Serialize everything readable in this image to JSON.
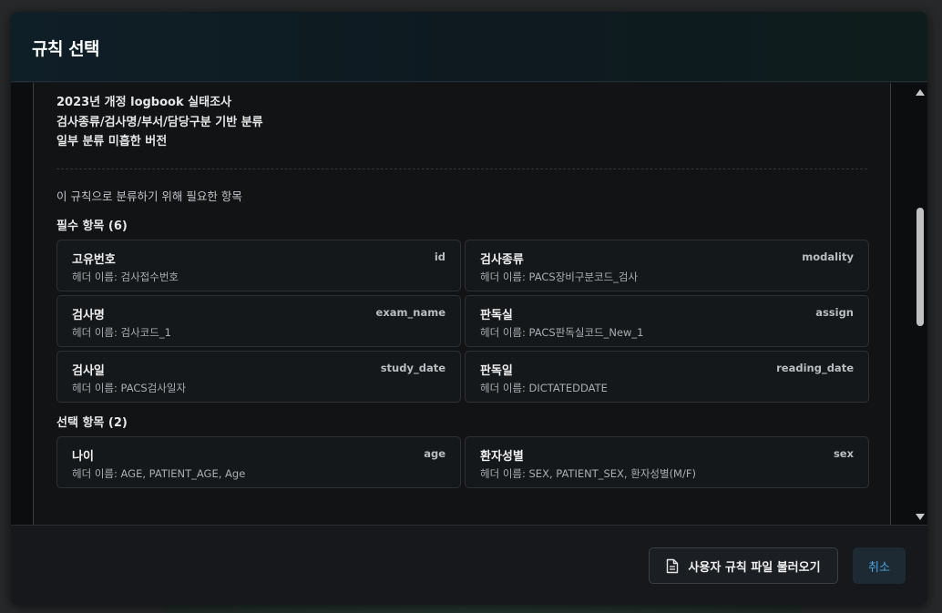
{
  "modal": {
    "title": "규칙 선택"
  },
  "rule": {
    "description_lines": [
      "2023년 개정 logbook 실태조사",
      "검사종류/검사명/부서/담당구분 기반 분류",
      "일부 분류 미흡한 버전"
    ],
    "required_fields_caption": "이 규칙으로 분류하기 위해 필요한 항목",
    "required_group_title": "필수 항목 (6)",
    "required_fields": [
      {
        "label": "고유번호",
        "key": "id",
        "header": "헤더 이름: 검사접수번호"
      },
      {
        "label": "검사종류",
        "key": "modality",
        "header": "헤더 이름: PACS장비구분코드_검사"
      },
      {
        "label": "검사명",
        "key": "exam_name",
        "header": "헤더 이름: 검사코드_1"
      },
      {
        "label": "판독실",
        "key": "assign",
        "header": "헤더 이름: PACS판독실코드_New_1"
      },
      {
        "label": "검사일",
        "key": "study_date",
        "header": "헤더 이름: PACS검사일자"
      },
      {
        "label": "판독일",
        "key": "reading_date",
        "header": "헤더 이름: DICTATEDDATE"
      }
    ],
    "optional_group_title": "선택 항목 (2)",
    "optional_fields": [
      {
        "label": "나이",
        "key": "age",
        "header": "헤더 이름: AGE, PATIENT_AGE, Age"
      },
      {
        "label": "환자성별",
        "key": "sex",
        "header": "헤더 이름: SEX, PATIENT_SEX, 환자성별(M/F)"
      }
    ]
  },
  "footer": {
    "load_button_label": "사용자 규칙 파일 불러오기",
    "load_button_icon": "file-text-icon",
    "cancel_button_label": "취소"
  },
  "colors": {
    "accent": "#4aa3e0",
    "header_bg": "#0f1f27"
  }
}
